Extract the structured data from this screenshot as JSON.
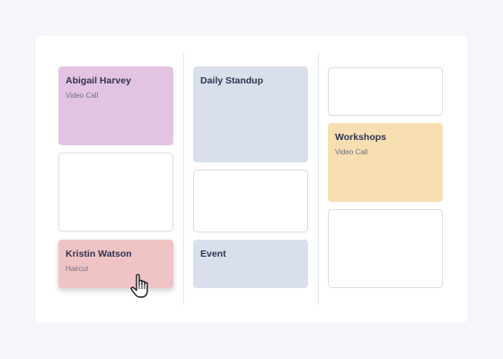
{
  "columns": [
    {
      "cards": [
        {
          "title": "Abigail Harvey",
          "subtitle": "Video Call",
          "color": "#e2c4e2"
        },
        {
          "title": "",
          "subtitle": "",
          "color": "#ffffff"
        },
        {
          "title": "Kristin Watson",
          "subtitle": "Haircut",
          "color": "#f0c3c5",
          "state": "dragging"
        }
      ]
    },
    {
      "cards": [
        {
          "title": "Daily Standup",
          "subtitle": "",
          "color": "#d9e0ec"
        },
        {
          "title": "",
          "subtitle": "",
          "color": "#ffffff"
        },
        {
          "title": "Event",
          "subtitle": "",
          "color": "#d9e0ec"
        }
      ]
    },
    {
      "cards": [
        {
          "title": "",
          "subtitle": "",
          "color": "#ffffff"
        },
        {
          "title": "Workshops",
          "subtitle": "Video Call",
          "color": "#f8dfb2"
        },
        {
          "title": "",
          "subtitle": "",
          "color": "#ffffff"
        }
      ]
    }
  ],
  "cursor": {
    "icon": "hand-pointer-icon"
  }
}
